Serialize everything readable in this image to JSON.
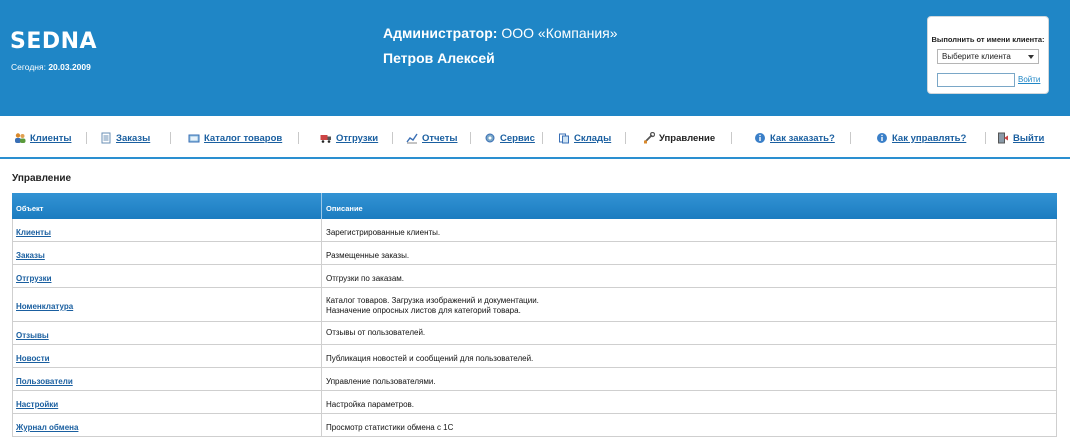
{
  "header": {
    "logo": "SEDNA",
    "today_label": "Сегодня: ",
    "today_value": "20.03.2009",
    "admin_label": "Администратор: ",
    "admin_company": "ООО «Компания»",
    "user_name": "Петров Алексей"
  },
  "client_box": {
    "title": "Выполнить от имени клиента:",
    "select_value": "Выберите клиента",
    "login_link": "Войти"
  },
  "nav": {
    "items": [
      {
        "label": "Клиенты",
        "icon": "users-icon"
      },
      {
        "label": "Заказы",
        "icon": "document-icon"
      },
      {
        "label": "Каталог товаров",
        "icon": "catalog-icon"
      },
      {
        "label": "Отгрузки",
        "icon": "truck-icon"
      },
      {
        "label": "Отчеты",
        "icon": "chart-icon"
      },
      {
        "label": "Сервис",
        "icon": "gear-icon"
      },
      {
        "label": "Склады",
        "icon": "warehouse-icon"
      },
      {
        "label": "Управление",
        "icon": "tools-icon"
      },
      {
        "label": "Как заказать?",
        "icon": "info-icon"
      },
      {
        "label": "Как управлять?",
        "icon": "info-icon"
      },
      {
        "label": "Выйти",
        "icon": "exit-icon"
      }
    ]
  },
  "section_title": "Управление",
  "table": {
    "col_object": "Объект",
    "col_description": "Описание",
    "rows": [
      {
        "object": "Клиенты",
        "description": "Зарегистрированные клиенты."
      },
      {
        "object": "Заказы",
        "description": "Размещенные заказы."
      },
      {
        "object": "Отгрузки",
        "description": "Отгрузки по заказам."
      },
      {
        "object": "Номенклатура",
        "description": "Каталог товаров. Загрузка изображений и документации.",
        "description2": "Назначение опросных листов для категорий товара."
      },
      {
        "object": "Отзывы",
        "description": "Отзывы от пользователей."
      },
      {
        "object": "Новости",
        "description": "Публикация новостей и сообщений для пользователей."
      },
      {
        "object": "Пользователи",
        "description": "Управление пользователями."
      },
      {
        "object": "Настройки",
        "description": "Настройка параметров."
      },
      {
        "object": "Журнал обмена",
        "description": "Просмотр статистики обмена с 1С"
      }
    ]
  },
  "colors": {
    "header_bg": "#1f86c6",
    "link": "#1a5fa0",
    "table_head": "#1b7cc0"
  }
}
